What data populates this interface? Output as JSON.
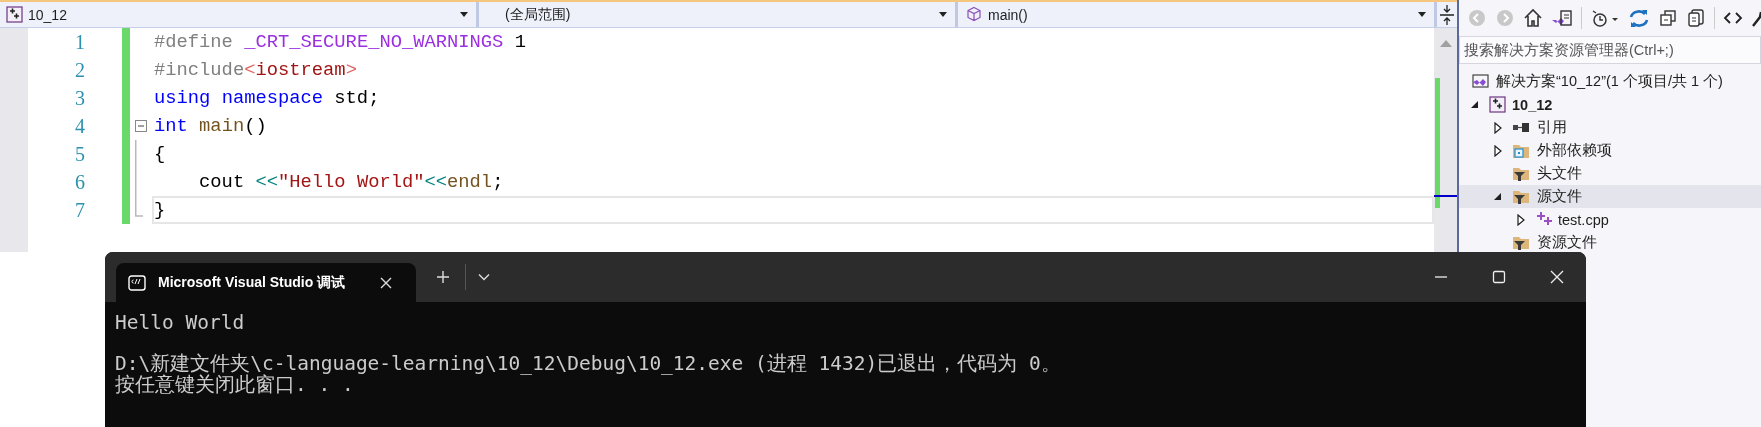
{
  "editor": {
    "navigation_bar": [
      {
        "label": "10_12",
        "kind": "project"
      },
      {
        "label": "(全局范围)",
        "kind": "scope"
      },
      {
        "label": "main()",
        "kind": "function"
      }
    ],
    "lines": [
      {
        "number": "1",
        "changed": true,
        "current": false,
        "kind": "plain",
        "tokens": [
          {
            "kind": "preproc",
            "text": "#define "
          },
          {
            "kind": "macro",
            "text": "_CRT_SECURE_NO_WARNINGS"
          },
          {
            "kind": "plain",
            "text": " 1"
          }
        ]
      },
      {
        "number": "2",
        "changed": true,
        "current": false,
        "kind": "plain",
        "tokens": [
          {
            "kind": "preproc",
            "text": "#include"
          },
          {
            "kind": "bracket",
            "text": "<"
          },
          {
            "kind": "path",
            "text": "iostream"
          },
          {
            "kind": "bracket",
            "text": ">"
          }
        ]
      },
      {
        "number": "3",
        "changed": true,
        "current": false,
        "kind": "plain",
        "tokens": [
          {
            "kind": "keyword",
            "text": "using "
          },
          {
            "kind": "keyword",
            "text": "namespace"
          },
          {
            "kind": "plain",
            "text": " std;"
          }
        ]
      },
      {
        "number": "4",
        "changed": true,
        "current": false,
        "kind": "fold-start",
        "tokens": [
          {
            "kind": "keyword",
            "text": "int "
          },
          {
            "kind": "function",
            "text": "main"
          },
          {
            "kind": "plain",
            "text": "()"
          }
        ]
      },
      {
        "number": "5",
        "changed": true,
        "current": false,
        "kind": "fold-body",
        "tokens": [
          {
            "kind": "plain",
            "text": "{"
          }
        ]
      },
      {
        "number": "6",
        "changed": true,
        "current": false,
        "kind": "fold-body",
        "tokens": [
          {
            "kind": "plain",
            "text": "    cout "
          },
          {
            "kind": "operator",
            "text": "<<"
          },
          {
            "kind": "string",
            "text": "\"Hello World\""
          },
          {
            "kind": "operator",
            "text": "<<"
          },
          {
            "kind": "function",
            "text": "endl"
          },
          {
            "kind": "plain",
            "text": ";"
          }
        ]
      },
      {
        "number": "7",
        "changed": true,
        "current": true,
        "kind": "fold-end",
        "tokens": [
          {
            "kind": "plain",
            "text": "}"
          }
        ]
      }
    ]
  },
  "solution_explorer": {
    "search": {
      "placeholder": "搜索解决方案资源管理器(Ctrl+;)"
    },
    "tree": [
      {
        "label": "解决方案“10_12”(1 个项目/共 1 个)",
        "kind": "solution",
        "selected": false,
        "bold": false,
        "children": [
          {
            "label": "10_12",
            "kind": "project",
            "expanded": true,
            "selected": false,
            "bold": true,
            "children": [
              {
                "label": "引用",
                "kind": "reference",
                "expanded": false,
                "selected": false,
                "bold": false
              },
              {
                "label": "外部依赖项",
                "kind": "external",
                "expanded": false,
                "selected": false,
                "bold": false
              },
              {
                "label": "头文件",
                "kind": "filter",
                "selected": false,
                "bold": false
              },
              {
                "label": "源文件",
                "kind": "filter",
                "expanded": true,
                "selected": true,
                "bold": false,
                "children": [
                  {
                    "label": "test.cpp",
                    "kind": "cpp",
                    "expanded": false,
                    "selected": false,
                    "bold": false
                  }
                ]
              },
              {
                "label": "资源文件",
                "kind": "filter",
                "selected": false,
                "bold": false
              }
            ]
          }
        ]
      }
    ]
  },
  "terminal": {
    "tab": {
      "title": "Microsoft Visual Studio 调试",
      "selected": true
    },
    "output": [
      [
        "Hello World"
      ],
      [
        "D:\\新建文件夹\\c-language-learning\\10_12\\Debug\\10_12.exe (进程 1432)已退出，代码为 0。",
        "按任意键关闭此窗口. . ."
      ]
    ]
  }
}
